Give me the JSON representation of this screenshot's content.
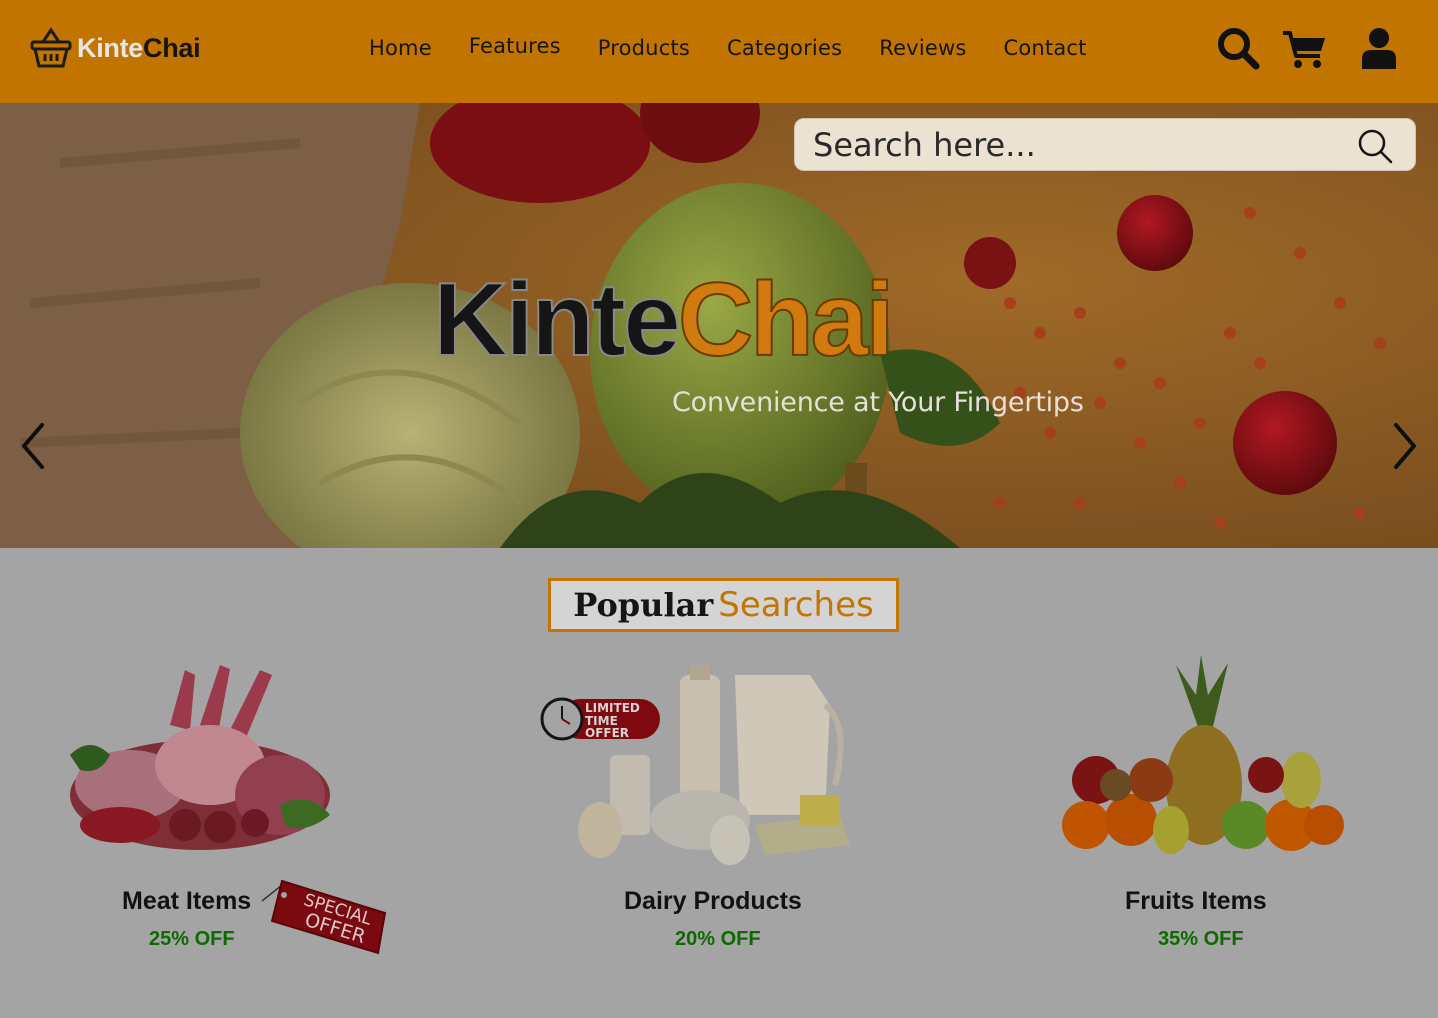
{
  "header": {
    "logo": {
      "part1": "Kinte",
      "part2": "Chai"
    },
    "nav": [
      "Home",
      "Features",
      "Products",
      "Categories",
      "Reviews",
      "Contact"
    ],
    "icons": [
      "search-icon",
      "cart-icon",
      "user-icon"
    ]
  },
  "search": {
    "placeholder": "Search here..."
  },
  "hero": {
    "title_part1": "Kinte",
    "title_part2": "Chai",
    "subtitle": "Convenience at Your Fingertips"
  },
  "popular": {
    "title_part1": "Popular",
    "title_part2": "Searches",
    "items": [
      {
        "title": "Meat Items",
        "discount": "25% OFF",
        "badge": "SPECIAL OFFER"
      },
      {
        "title": "Dairy Products",
        "discount": "20% OFF",
        "badge": "LIMITED TIME OFFER"
      },
      {
        "title": "Fruits Items",
        "discount": "35% OFF"
      }
    ]
  },
  "colors": {
    "brand": "#c27400",
    "discount": "#0e6a00",
    "background": "#a4a4a4"
  }
}
